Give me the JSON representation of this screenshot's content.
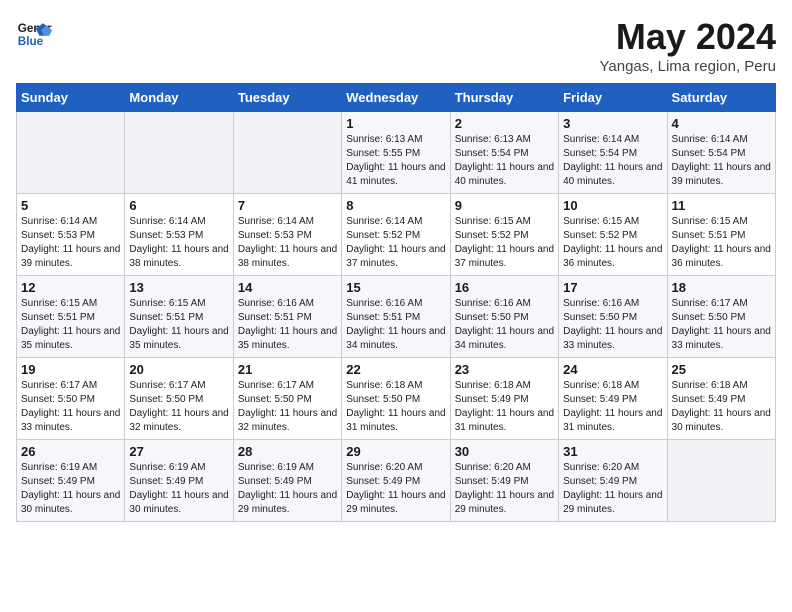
{
  "header": {
    "logo_line1": "General",
    "logo_line2": "Blue",
    "month": "May 2024",
    "location": "Yangas, Lima region, Peru"
  },
  "weekdays": [
    "Sunday",
    "Monday",
    "Tuesday",
    "Wednesday",
    "Thursday",
    "Friday",
    "Saturday"
  ],
  "weeks": [
    [
      {
        "day": "",
        "info": ""
      },
      {
        "day": "",
        "info": ""
      },
      {
        "day": "",
        "info": ""
      },
      {
        "day": "1",
        "info": "Sunrise: 6:13 AM\nSunset: 5:55 PM\nDaylight: 11 hours and 41 minutes."
      },
      {
        "day": "2",
        "info": "Sunrise: 6:13 AM\nSunset: 5:54 PM\nDaylight: 11 hours and 40 minutes."
      },
      {
        "day": "3",
        "info": "Sunrise: 6:14 AM\nSunset: 5:54 PM\nDaylight: 11 hours and 40 minutes."
      },
      {
        "day": "4",
        "info": "Sunrise: 6:14 AM\nSunset: 5:54 PM\nDaylight: 11 hours and 39 minutes."
      }
    ],
    [
      {
        "day": "5",
        "info": "Sunrise: 6:14 AM\nSunset: 5:53 PM\nDaylight: 11 hours and 39 minutes."
      },
      {
        "day": "6",
        "info": "Sunrise: 6:14 AM\nSunset: 5:53 PM\nDaylight: 11 hours and 38 minutes."
      },
      {
        "day": "7",
        "info": "Sunrise: 6:14 AM\nSunset: 5:53 PM\nDaylight: 11 hours and 38 minutes."
      },
      {
        "day": "8",
        "info": "Sunrise: 6:14 AM\nSunset: 5:52 PM\nDaylight: 11 hours and 37 minutes."
      },
      {
        "day": "9",
        "info": "Sunrise: 6:15 AM\nSunset: 5:52 PM\nDaylight: 11 hours and 37 minutes."
      },
      {
        "day": "10",
        "info": "Sunrise: 6:15 AM\nSunset: 5:52 PM\nDaylight: 11 hours and 36 minutes."
      },
      {
        "day": "11",
        "info": "Sunrise: 6:15 AM\nSunset: 5:51 PM\nDaylight: 11 hours and 36 minutes."
      }
    ],
    [
      {
        "day": "12",
        "info": "Sunrise: 6:15 AM\nSunset: 5:51 PM\nDaylight: 11 hours and 35 minutes."
      },
      {
        "day": "13",
        "info": "Sunrise: 6:15 AM\nSunset: 5:51 PM\nDaylight: 11 hours and 35 minutes."
      },
      {
        "day": "14",
        "info": "Sunrise: 6:16 AM\nSunset: 5:51 PM\nDaylight: 11 hours and 35 minutes."
      },
      {
        "day": "15",
        "info": "Sunrise: 6:16 AM\nSunset: 5:51 PM\nDaylight: 11 hours and 34 minutes."
      },
      {
        "day": "16",
        "info": "Sunrise: 6:16 AM\nSunset: 5:50 PM\nDaylight: 11 hours and 34 minutes."
      },
      {
        "day": "17",
        "info": "Sunrise: 6:16 AM\nSunset: 5:50 PM\nDaylight: 11 hours and 33 minutes."
      },
      {
        "day": "18",
        "info": "Sunrise: 6:17 AM\nSunset: 5:50 PM\nDaylight: 11 hours and 33 minutes."
      }
    ],
    [
      {
        "day": "19",
        "info": "Sunrise: 6:17 AM\nSunset: 5:50 PM\nDaylight: 11 hours and 33 minutes."
      },
      {
        "day": "20",
        "info": "Sunrise: 6:17 AM\nSunset: 5:50 PM\nDaylight: 11 hours and 32 minutes."
      },
      {
        "day": "21",
        "info": "Sunrise: 6:17 AM\nSunset: 5:50 PM\nDaylight: 11 hours and 32 minutes."
      },
      {
        "day": "22",
        "info": "Sunrise: 6:18 AM\nSunset: 5:50 PM\nDaylight: 11 hours and 31 minutes."
      },
      {
        "day": "23",
        "info": "Sunrise: 6:18 AM\nSunset: 5:49 PM\nDaylight: 11 hours and 31 minutes."
      },
      {
        "day": "24",
        "info": "Sunrise: 6:18 AM\nSunset: 5:49 PM\nDaylight: 11 hours and 31 minutes."
      },
      {
        "day": "25",
        "info": "Sunrise: 6:18 AM\nSunset: 5:49 PM\nDaylight: 11 hours and 30 minutes."
      }
    ],
    [
      {
        "day": "26",
        "info": "Sunrise: 6:19 AM\nSunset: 5:49 PM\nDaylight: 11 hours and 30 minutes."
      },
      {
        "day": "27",
        "info": "Sunrise: 6:19 AM\nSunset: 5:49 PM\nDaylight: 11 hours and 30 minutes."
      },
      {
        "day": "28",
        "info": "Sunrise: 6:19 AM\nSunset: 5:49 PM\nDaylight: 11 hours and 29 minutes."
      },
      {
        "day": "29",
        "info": "Sunrise: 6:20 AM\nSunset: 5:49 PM\nDaylight: 11 hours and 29 minutes."
      },
      {
        "day": "30",
        "info": "Sunrise: 6:20 AM\nSunset: 5:49 PM\nDaylight: 11 hours and 29 minutes."
      },
      {
        "day": "31",
        "info": "Sunrise: 6:20 AM\nSunset: 5:49 PM\nDaylight: 11 hours and 29 minutes."
      },
      {
        "day": "",
        "info": ""
      }
    ]
  ]
}
